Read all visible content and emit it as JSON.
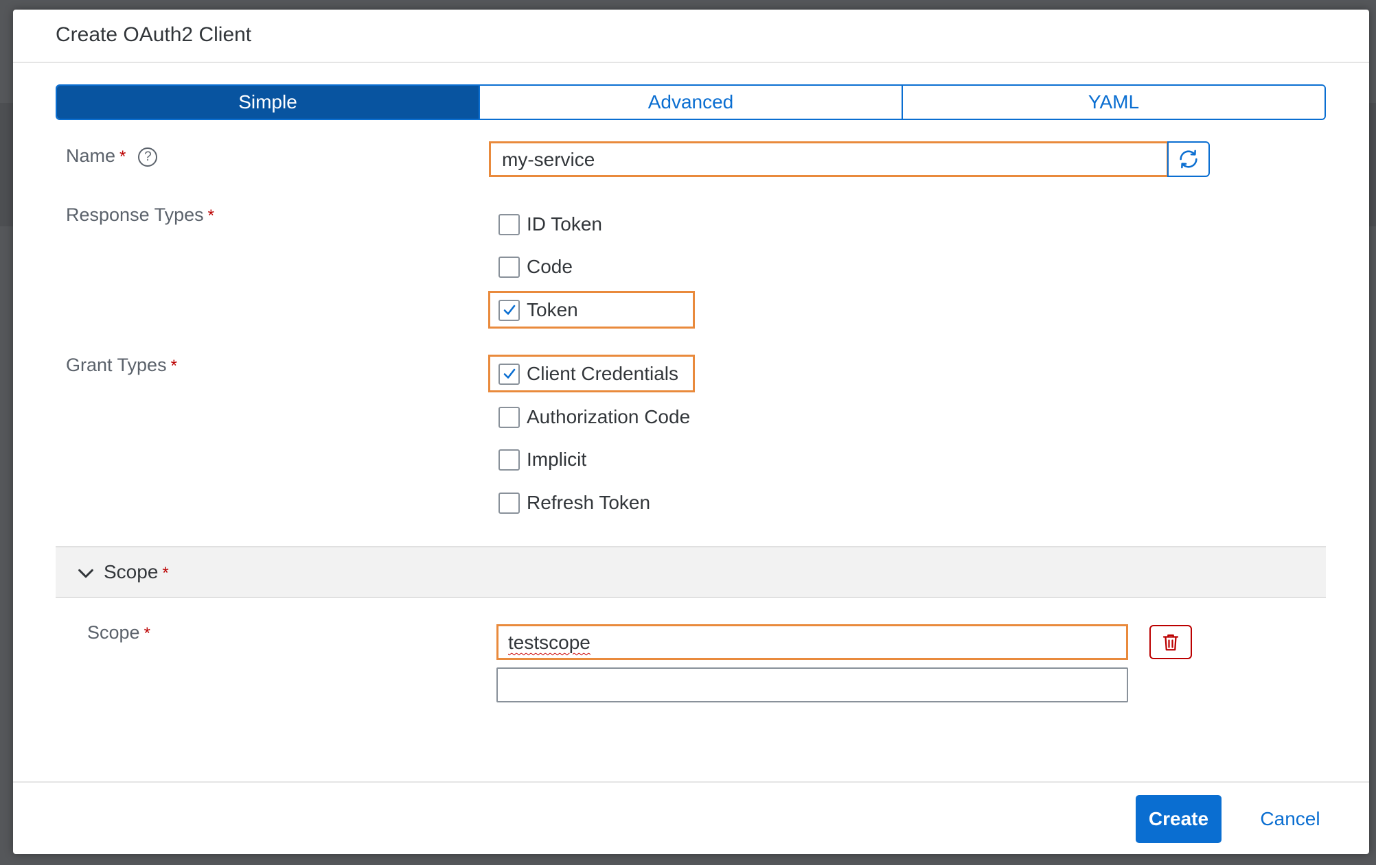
{
  "dialog": {
    "title": "Create OAuth2 Client"
  },
  "tabs": [
    {
      "label": "Simple",
      "active": true
    },
    {
      "label": "Advanced",
      "active": false
    },
    {
      "label": "YAML",
      "active": false
    }
  ],
  "name_field": {
    "label": "Name",
    "required_mark": "*",
    "help_icon": "question-circle-icon",
    "value": "my-service",
    "refresh_icon": "refresh-icon"
  },
  "response_types": {
    "label": "Response Types",
    "required_mark": "*",
    "options": [
      {
        "label": "ID Token",
        "checked": false
      },
      {
        "label": "Code",
        "checked": false
      },
      {
        "label": "Token",
        "checked": true
      }
    ]
  },
  "grant_types": {
    "label": "Grant Types",
    "required_mark": "*",
    "options": [
      {
        "label": "Client Credentials",
        "checked": true
      },
      {
        "label": "Authorization Code",
        "checked": false
      },
      {
        "label": "Implicit",
        "checked": false
      },
      {
        "label": "Refresh Token",
        "checked": false
      }
    ]
  },
  "scope_panel": {
    "title": "Scope",
    "required_mark": "*",
    "expanded": true,
    "field_label": "Scope",
    "field_required_mark": "*",
    "values": [
      "testscope",
      ""
    ],
    "delete_icon": "trash-icon"
  },
  "footer": {
    "create_label": "Create",
    "cancel_label": "Cancel"
  },
  "colors": {
    "accent": "#0a6ed1",
    "active_tab": "#0854a0",
    "highlight": "#e98a3c",
    "required": "#bb0000"
  }
}
